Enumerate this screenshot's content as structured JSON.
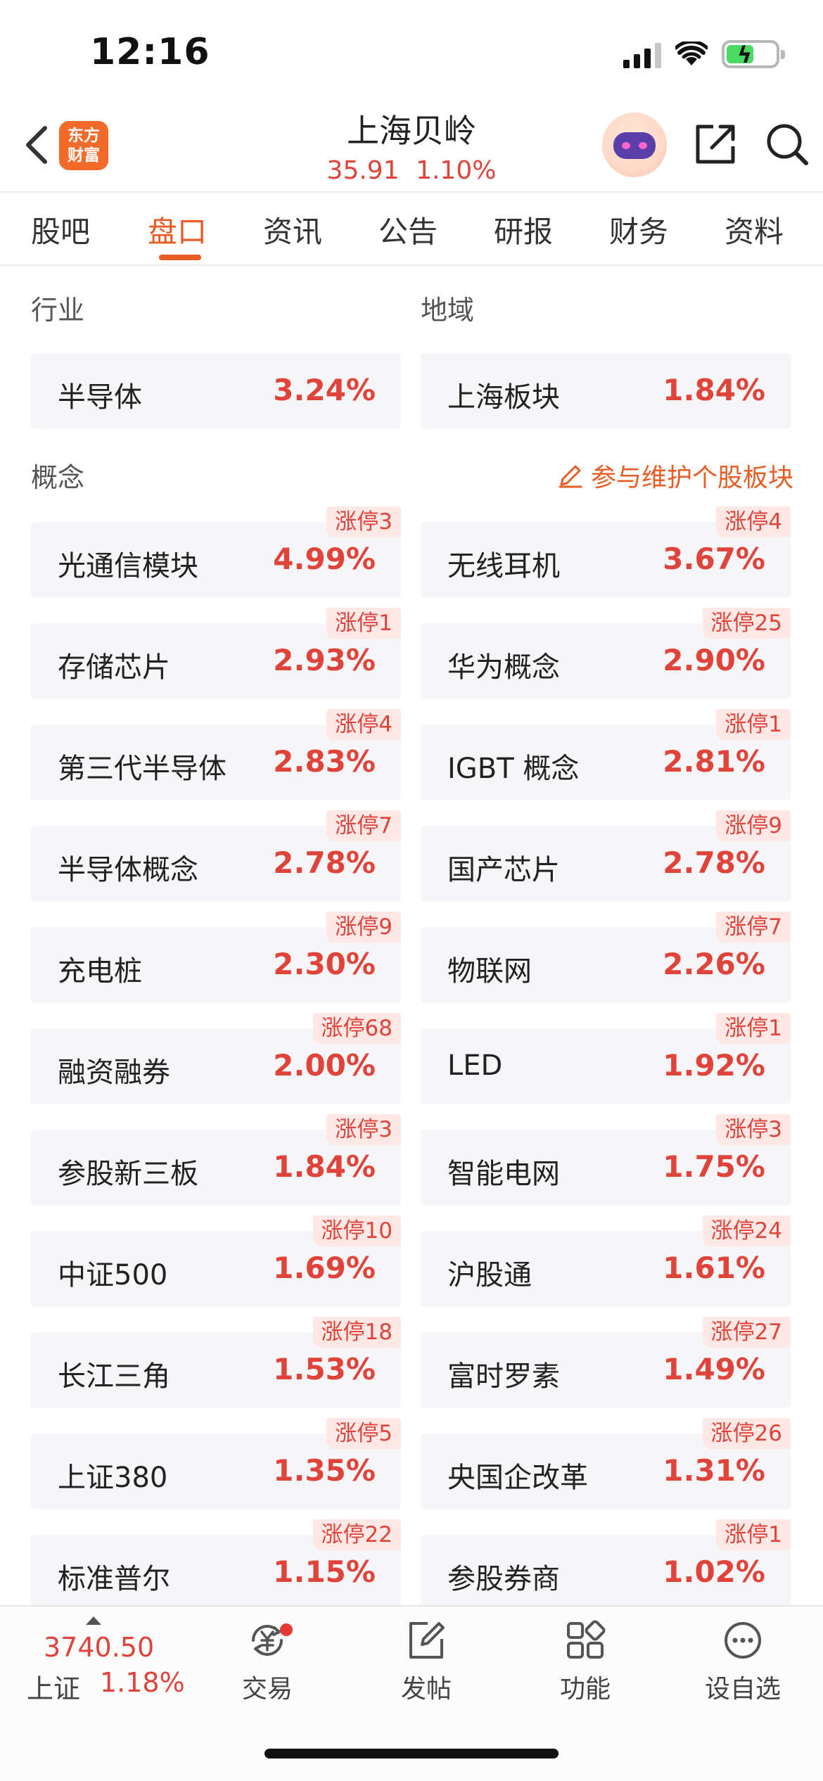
{
  "status": {
    "time": "12:16"
  },
  "header": {
    "logo_line1": "东方",
    "logo_line2": "财富",
    "stock_name": "上海贝岭",
    "price": "35.91",
    "change_pct": "1.10%"
  },
  "tabs": [
    "股吧",
    "盘口",
    "资讯",
    "公告",
    "研报",
    "财务",
    "资料"
  ],
  "active_tab": "盘口",
  "sections": {
    "industry_label": "行业",
    "region_label": "地域",
    "concept_label": "概念",
    "maintain_link": "参与维护个股板块"
  },
  "industry": {
    "name": "半导体",
    "pct": "3.24%"
  },
  "region": {
    "name": "上海板块",
    "pct": "1.84%"
  },
  "concepts": [
    {
      "name": "光通信模块",
      "pct": "4.99%",
      "badge": "涨停3"
    },
    {
      "name": "无线耳机",
      "pct": "3.67%",
      "badge": "涨停4"
    },
    {
      "name": "存储芯片",
      "pct": "2.93%",
      "badge": "涨停1"
    },
    {
      "name": "华为概念",
      "pct": "2.90%",
      "badge": "涨停25"
    },
    {
      "name": "第三代半导体",
      "pct": "2.83%",
      "badge": "涨停4"
    },
    {
      "name": "IGBT 概念",
      "pct": "2.81%",
      "badge": "涨停1"
    },
    {
      "name": "半导体概念",
      "pct": "2.78%",
      "badge": "涨停7"
    },
    {
      "name": "国产芯片",
      "pct": "2.78%",
      "badge": "涨停9"
    },
    {
      "name": "充电桩",
      "pct": "2.30%",
      "badge": "涨停9"
    },
    {
      "name": "物联网",
      "pct": "2.26%",
      "badge": "涨停7"
    },
    {
      "name": "融资融券",
      "pct": "2.00%",
      "badge": "涨停68"
    },
    {
      "name": "LED",
      "pct": "1.92%",
      "badge": "涨停1"
    },
    {
      "name": "参股新三板",
      "pct": "1.84%",
      "badge": "涨停3"
    },
    {
      "name": "智能电网",
      "pct": "1.75%",
      "badge": "涨停3"
    },
    {
      "name": "中证500",
      "pct": "1.69%",
      "badge": "涨停10"
    },
    {
      "name": "沪股通",
      "pct": "1.61%",
      "badge": "涨停24"
    },
    {
      "name": "长江三角",
      "pct": "1.53%",
      "badge": "涨停18"
    },
    {
      "name": "富时罗素",
      "pct": "1.49%",
      "badge": "涨停27"
    },
    {
      "name": "上证380",
      "pct": "1.35%",
      "badge": "涨停5"
    },
    {
      "name": "央国企改革",
      "pct": "1.31%",
      "badge": "涨停26"
    },
    {
      "name": "标准普尔",
      "pct": "1.15%",
      "badge": "涨停22"
    },
    {
      "name": "参股券商",
      "pct": "1.02%",
      "badge": "涨停1"
    }
  ],
  "bottom_bar": {
    "index_value": "3740.50",
    "index_name": "上证",
    "index_pct": "1.18%",
    "nav": [
      "交易",
      "发帖",
      "功能",
      "设自选"
    ]
  },
  "colors": {
    "accent": "#e85d26",
    "up": "#e0433a",
    "badge_bg": "#fde8e6",
    "card_bg": "#f6f6f8"
  }
}
